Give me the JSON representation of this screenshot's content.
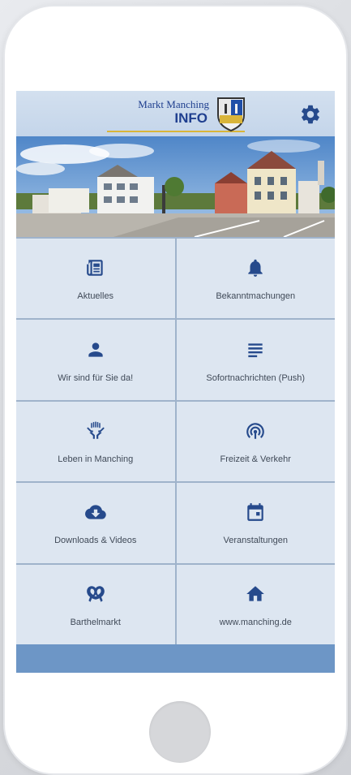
{
  "header": {
    "logo_line1": "Markt Manching",
    "logo_line2": "INFO",
    "settings_icon": "gear-icon"
  },
  "tiles": [
    {
      "label": "Aktuelles",
      "icon": "newspaper-icon"
    },
    {
      "label": "Bekanntmachungen",
      "icon": "bell-icon"
    },
    {
      "label": "Wir sind für Sie da!",
      "icon": "person-icon"
    },
    {
      "label": "Sofortnachrichten (Push)",
      "icon": "lines-icon"
    },
    {
      "label": "Leben in Manching",
      "icon": "hands-icon"
    },
    {
      "label": "Freizeit & Verkehr",
      "icon": "signal-icon"
    },
    {
      "label": "Downloads & Videos",
      "icon": "cloud-download-icon"
    },
    {
      "label": "Veranstaltungen",
      "icon": "calendar-icon"
    },
    {
      "label": "Barthelmarkt",
      "icon": "pretzel-icon"
    },
    {
      "label": "www.manching.de",
      "icon": "home-icon"
    }
  ],
  "colors": {
    "accent": "#264a8c",
    "tile_bg": "#dde6f1",
    "footer_bar": "#6d96c6"
  }
}
